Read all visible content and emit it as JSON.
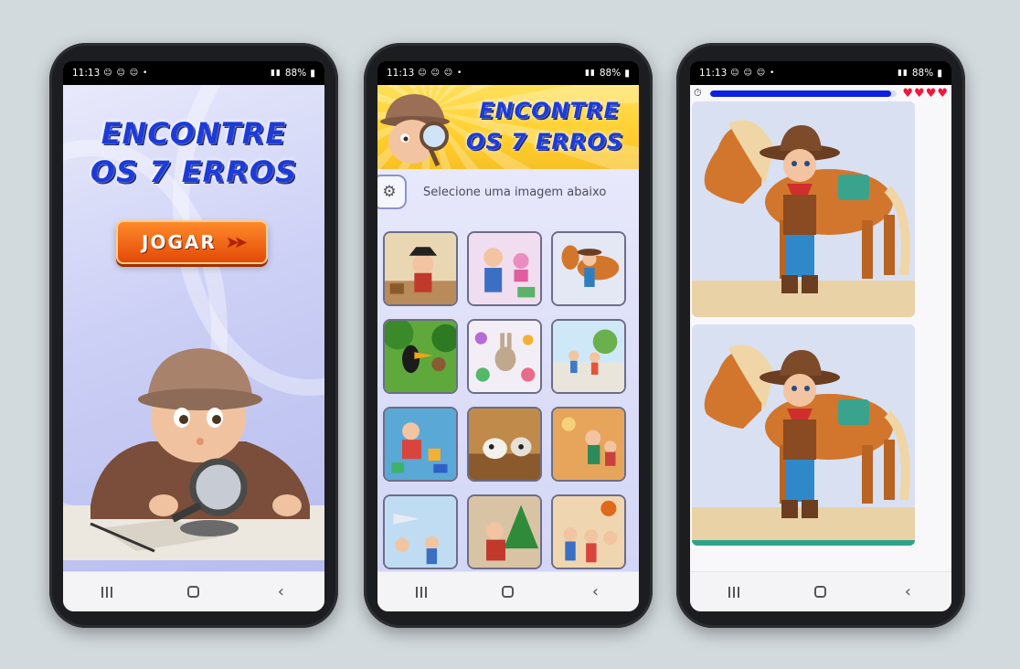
{
  "status": {
    "time": "11:13",
    "notif_icons": "☺ ☺ ☺ •",
    "battery": "88%"
  },
  "screen1": {
    "title_line1": "ENCONTRE",
    "title_line2": "OS 7 ERROS",
    "play_label": "JOGAR"
  },
  "screen2": {
    "title_line1": "ENCONTRE",
    "title_line2": "OS 7 ERROS",
    "select_label": "Selecione uma imagem abaixo",
    "thumbnails": [
      "pirate",
      "kids-school",
      "cowboy-horse",
      "toucan-jungle",
      "bunny-animals",
      "park-kids",
      "boy-blocks",
      "dogs-toys",
      "kids-playing",
      "airplanes",
      "christmas",
      "basketball"
    ]
  },
  "screen3": {
    "timer_progress": 0.97,
    "lives": 4
  },
  "colors": {
    "title_blue": "#1d3bd6",
    "play_orange": "#ff7a1f",
    "progress_blue": "#0d1fe3",
    "heart_red": "#f2163a"
  }
}
